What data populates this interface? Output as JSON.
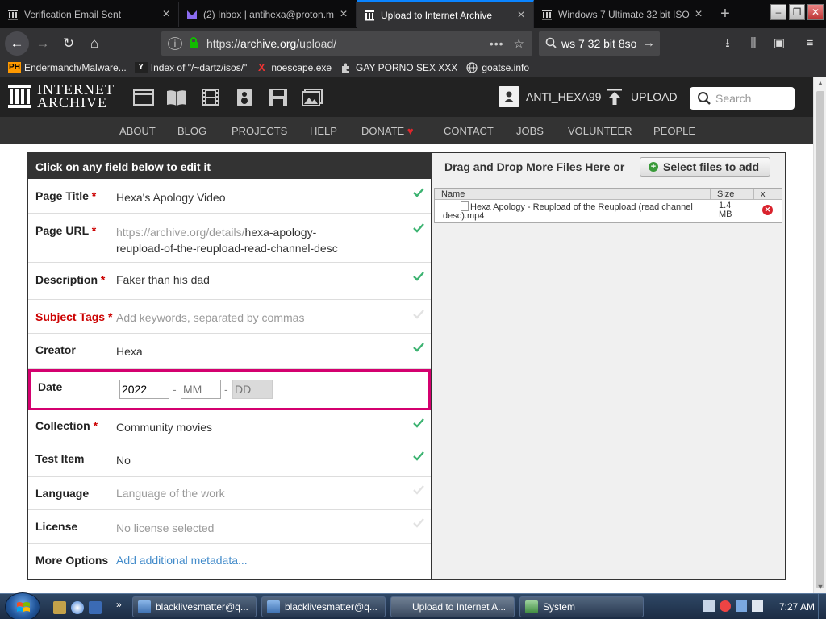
{
  "browser": {
    "tabs": [
      {
        "title": "Verification Email Sent",
        "icon": "archive-icon"
      },
      {
        "title": "(2) Inbox | antihexa@proton.m",
        "icon": "protonmail-icon"
      },
      {
        "title": "Upload to Internet Archive",
        "icon": "archive-icon",
        "active": true
      },
      {
        "title": "Windows 7 Ultimate 32 bit ISO",
        "icon": "archive-icon"
      }
    ],
    "url_scheme": "https://",
    "url_domain": "archive.org",
    "url_path": "/upload/",
    "search_value": "ws 7 32 bit 8so",
    "bookmarks": [
      {
        "label": "Endermanch/Malware...",
        "icon_text": "PH"
      },
      {
        "label": "Index of \"/~dartz/isos/\"",
        "icon_text": "Y"
      },
      {
        "label": "noescape.exe",
        "icon_text": "X"
      },
      {
        "label": "GAY PORNO SEX XXX",
        "icon_text": ""
      },
      {
        "label": "goatse.info",
        "icon_text": ""
      }
    ]
  },
  "ia": {
    "logo_line1": "INTERNET",
    "logo_line2": "ARCHIVE",
    "username": "ANTI_HEXA99",
    "upload_label": "UPLOAD",
    "search_placeholder": "Search",
    "nav": [
      "ABOUT",
      "BLOG",
      "PROJECTS",
      "HELP",
      "DONATE",
      "CONTACT",
      "JOBS",
      "VOLUNTEER",
      "PEOPLE"
    ]
  },
  "form": {
    "header": "Click on any field below to edit it",
    "required_mark": "*",
    "page_title_label": "Page Title",
    "page_title_value": "Hexa's Apology Video",
    "page_url_label": "Page URL",
    "page_url_prefix": "https://archive.org/details/",
    "page_url_slug1": "hexa-apology-",
    "page_url_slug2": "reupload-of-the-reupload-read-channel-desc",
    "description_label": "Description",
    "description_value": "Faker than his dad",
    "subject_label": "Subject Tags",
    "subject_placeholder": "Add keywords, separated by commas",
    "creator_label": "Creator",
    "creator_value": "Hexa",
    "date_label": "Date",
    "date_year": "2022",
    "date_month_placeholder": "MM",
    "date_day_placeholder": "DD",
    "date_sep": "-",
    "collection_label": "Collection",
    "collection_value": "Community movies",
    "test_label": "Test Item",
    "test_value": "No",
    "language_label": "Language",
    "language_placeholder": "Language of the work",
    "license_label": "License",
    "license_value": "No license selected",
    "more_label": "More Options",
    "more_link": "Add additional metadata..."
  },
  "files": {
    "header": "Drag and Drop More Files Here or",
    "select_button": "Select files to add",
    "col_name": "Name",
    "col_size": "Size",
    "col_x": "x",
    "file_name": "Hexa Apology - Reupload of the Reupload (read channel desc).mp4",
    "file_size_num": "1.4",
    "file_size_unit": "MB"
  },
  "taskbar": {
    "buttons": [
      "blacklivesmatter@q...",
      "blacklivesmatter@q...",
      "Upload to Internet A...",
      "System"
    ],
    "clock": "7:27 AM"
  },
  "colors": {
    "accent_firefox": "#0a84ff",
    "ia_dark": "#222222",
    "date_highlight": "#d4006f",
    "required_red": "#cc0000",
    "check_green": "#3cb371"
  }
}
